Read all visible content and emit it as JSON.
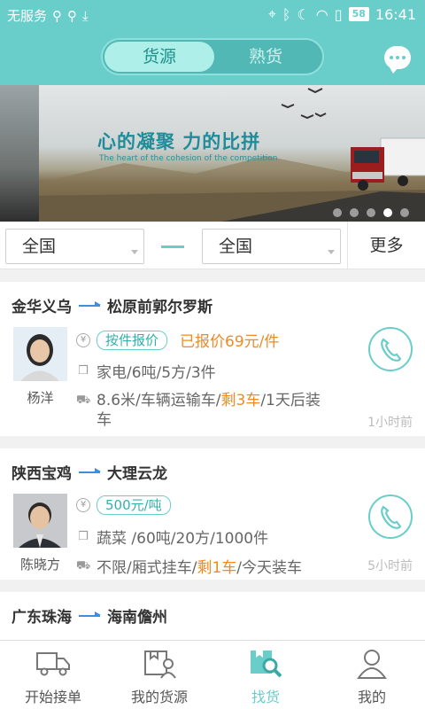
{
  "status_bar": {
    "carrier": "无服务",
    "battery": "58",
    "time": "16:41"
  },
  "header": {
    "tabs": [
      {
        "label": "货源",
        "active": true
      },
      {
        "label": "熟货",
        "active": false
      }
    ],
    "chat_icon": "chat-bubble-icon"
  },
  "banner": {
    "slogan": "心的凝聚 力的比拼",
    "slogan_en": "The heart of the cohesion of the competition",
    "slide_count": 5,
    "active_slide": 4
  },
  "filter": {
    "from": "全国",
    "to": "全国",
    "more": "更多"
  },
  "listings": [
    {
      "from": "金华义乌",
      "to": "松原前郭尔罗斯",
      "name": "杨洋",
      "price_tag": "按件报价",
      "quoted": "已报价69元/件",
      "goods": "家电/6吨/5方/3件",
      "truck_prefix": "8.6米/车辆运输车/",
      "remaining": "剩3车",
      "truck_suffix": "/1天后装",
      "truck_wrap": "车",
      "time": "1小时前"
    },
    {
      "from": "陕西宝鸡",
      "to": "大理云龙",
      "name": "陈晓方",
      "price_tag": "500元/吨",
      "goods": "蔬菜  /60吨/20方/1000件",
      "truck_prefix": "不限/厢式挂车/",
      "remaining": "剩1车",
      "truck_suffix": "/今天装车",
      "time": "5小时前"
    },
    {
      "from": "广东珠海",
      "to": "海南儋州"
    }
  ],
  "tabbar": [
    {
      "label": "开始接单",
      "icon": "truck-icon",
      "active": false
    },
    {
      "label": "我的货源",
      "icon": "my-cargo-icon",
      "active": false
    },
    {
      "label": "找货",
      "icon": "find-cargo-icon",
      "active": true
    },
    {
      "label": "我的",
      "icon": "user-icon",
      "active": false
    }
  ],
  "colors": {
    "accent": "#69cdca",
    "orange": "#f08a22",
    "route_arrow": "#3d8ede"
  }
}
